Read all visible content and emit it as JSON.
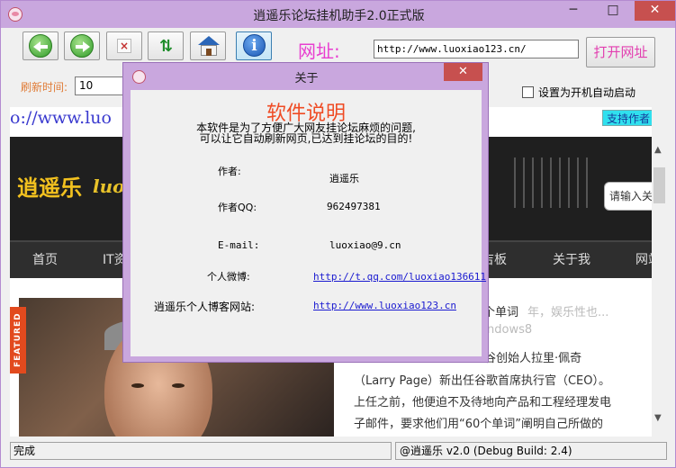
{
  "window": {
    "title": "逍遥乐论坛挂机助手2.0正式版",
    "close_glyph": "✕",
    "min_glyph": "─",
    "max_glyph": "□"
  },
  "toolbar": {
    "address_label": "网址:",
    "url_value": "http://www.luoxiao123.cn/",
    "open_button": "打开网址",
    "refresh_label": "刷新时间:",
    "refresh_value": "10",
    "autostart_label": "设置为开机自动启动",
    "icons": [
      "back-icon",
      "forward-icon",
      "stop-icon",
      "refresh-icon",
      "home-icon",
      "info-icon"
    ]
  },
  "browser": {
    "url_text": "o://www.luo",
    "support_button": "支持作者",
    "logo_text": "逍遥乐",
    "logo_latin": "luo",
    "search_placeholder": "请输入关",
    "nav": [
      "首页",
      "IT资",
      "吉板",
      "关于我",
      "网站"
    ],
    "featured": "FEATURED",
    "article_title": "个单词",
    "article_faded": "年，娱乐性也...",
    "article_faded2": "ndows8",
    "paragraph": [
      "谷创始人拉里·佩奇",
      "（Larry Page）新出任谷歌首席执行官（CEO）。",
      "上任之前，他便迫不及待地向产品和工程经理发电",
      "子邮件，要求他们用“60个单词”阐明自己所做的"
    ]
  },
  "status": {
    "left": "完成",
    "right": "@逍遥乐 v2.0 (Debug Build: 2.4)"
  },
  "dialog": {
    "title": "关于",
    "close_glyph": "✕",
    "heading": "软件说明",
    "desc_line1": "本软件是为了方便广大网友挂论坛麻烦的问题,",
    "desc_line2": "可以让它自动刷新网页,已达到挂论坛的目的!",
    "author_label": "作者:",
    "author_value": "逍遥乐",
    "qq_label": "作者QQ:",
    "qq_value": "962497381",
    "email_label": "E-mail:",
    "email_value": "luoxiao@9.cn",
    "weibo_label": "个人微博:",
    "weibo_value": "http://t.qq.com/luoxiao136611",
    "blog_label": "逍遥乐个人博客网站:",
    "blog_value": "http://www.luoxiao123.cn"
  }
}
